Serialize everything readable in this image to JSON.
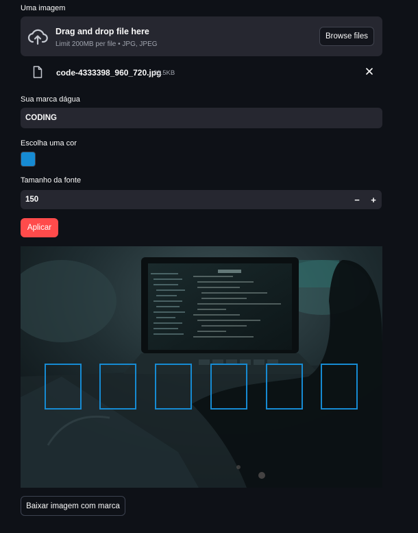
{
  "uploader": {
    "label": "Uma imagem",
    "dropzone_title": "Drag and drop file here",
    "dropzone_sub": "Limit 200MB per file • JPG, JPEG",
    "browse_label": "Browse files"
  },
  "file": {
    "name": "code-4333398_960_720.jpg",
    "size": "28.5KB"
  },
  "watermark": {
    "label": "Sua marca dágua",
    "value": "CODING"
  },
  "color": {
    "label": "Escolha uma cor",
    "value": "#168bd3"
  },
  "font_size": {
    "label": "Tamanho da fonte",
    "value": "150",
    "minus": "−",
    "plus": "+"
  },
  "apply_label": "Aplicar",
  "download_label": "Baixar imagem com marca",
  "icons": {
    "upload": "cloud-upload-icon",
    "file": "file-icon",
    "close": "close-icon"
  }
}
